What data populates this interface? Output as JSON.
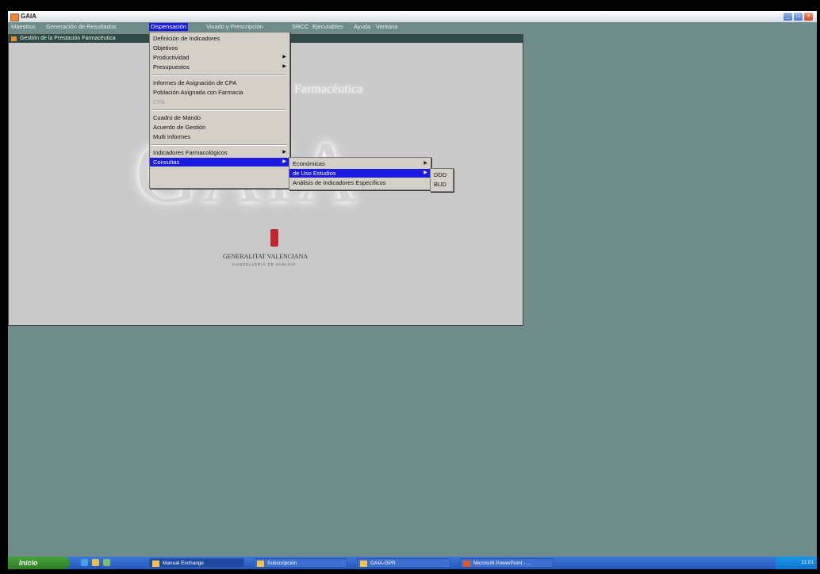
{
  "window": {
    "title": "GAIA"
  },
  "menubar": [
    "Maestros",
    "Generación de Resultados",
    "Dispensación",
    "Visado y Prescripción",
    "SRCC",
    "Ejecutables",
    "Ayuda",
    "Ventana"
  ],
  "inner_window": {
    "title": "Gestión de la Prestación Farmacéutica"
  },
  "splash": {
    "subtitle": "Farmacéutica",
    "logo_text": "GAIA",
    "org_name": "GENERALITAT VALENCIANA",
    "org_sub": "CONSELLERIA DE SANITAT"
  },
  "dispensacion_menu": {
    "items": [
      {
        "label": "Definición de Indicadores",
        "arrow": ""
      },
      {
        "label": "Objetivos",
        "arrow": ""
      },
      {
        "label": "Productividad",
        "arrow": "▶"
      },
      {
        "label": "Presupuestos",
        "arrow": "▶"
      },
      {
        "label": "Informes de Asignación de CPA",
        "arrow": ""
      },
      {
        "label": "Población Asignada con Farmacia",
        "arrow": ""
      },
      {
        "label": "CPA",
        "arrow": ""
      },
      {
        "label": "Cuadro de Mando",
        "arrow": ""
      },
      {
        "label": "Acuerdo de Gestión",
        "arrow": ""
      },
      {
        "label": "Multi Informes",
        "arrow": ""
      },
      {
        "label": "Indicadores Farmacológicos",
        "arrow": "▶"
      },
      {
        "label": "Consultas",
        "arrow": "▶"
      }
    ]
  },
  "consultas_menu": {
    "items": [
      {
        "label": "Económicas",
        "arrow": "▶"
      },
      {
        "label": "de Uso Estudios",
        "arrow": "▶"
      },
      {
        "label": "Análisis de Indicadores Específicos",
        "arrow": ""
      }
    ]
  },
  "uso_menu": {
    "items": [
      "DDD",
      "BUD"
    ]
  },
  "taskbar": {
    "start_label": "Inicio",
    "tasks": [
      "Manual Exchange",
      "Subscripción",
      "GAIA-GPR",
      "Microsoft PowerPoint - ..."
    ],
    "clock": "11:01"
  }
}
